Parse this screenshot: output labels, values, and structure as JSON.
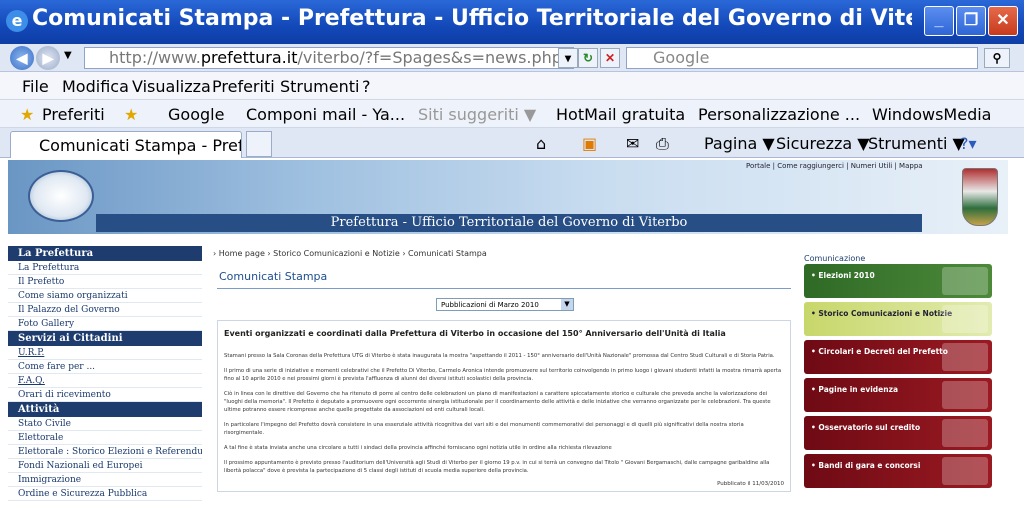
{
  "window": {
    "title": "Comunicati Stampa - Prefettura - Ufficio Territoriale del Governo di Viterbo - W..."
  },
  "address": {
    "url_prefix": "http://www.",
    "url_domain": "prefettura.it",
    "url_rest": "/viterbo/?f=Spages&s=news.php&id_a",
    "search_placeholder": "Google"
  },
  "menu": [
    "File",
    "Modifica",
    "Visualizza",
    "Preferiti",
    "Strumenti",
    "?"
  ],
  "favorites": {
    "label": "Preferiti",
    "items": [
      "Google",
      "Componi mail - Ya...",
      "Siti suggeriti ▼",
      "HotMail gratuita",
      "Personalizzazione ...",
      "WindowsMedia"
    ]
  },
  "tab": {
    "label": "Comunicati Stampa - Prefe..."
  },
  "commands": {
    "page": "Pagina ▼",
    "security": "Sicurezza ▼",
    "tools": "Strumenti ▼"
  },
  "site": {
    "top_links": "Portale | Come raggiungerci | Numeri Utili | Mappa",
    "banner_title": "Prefettura - Ufficio Territoriale del Governo di Viterbo",
    "breadcrumb": "› Home page  › Storico Comunicazioni e Notizie  › Comunicati Stampa",
    "page_title": "Comunicati Stampa",
    "select_value": "Pubblicazioni di Marzo 2010",
    "sections": [
      {
        "title": "La Prefettura",
        "items": [
          "La Prefettura",
          "Il Prefetto",
          "Come siamo organizzati",
          "Il Palazzo del Governo",
          "Foto Gallery"
        ]
      },
      {
        "title": "Servizi ai Cittadini",
        "items": [
          "U.R.P.",
          "Come fare per ...",
          "F.A.Q.",
          "Orari di ricevimento"
        ]
      },
      {
        "title": "Attività",
        "items": [
          "Stato Civile",
          "Elettorale",
          "Elettorale : Storico Elezioni e Referendum",
          "Fondi Nazionali ed Europei",
          "Immigrazione",
          "Ordine e Sicurezza Pubblica"
        ]
      }
    ],
    "article": {
      "heading": "Eventi organizzati e coordinati dalla Prefettura di Viterbo in occasione del 150° Anniversario dell'Unità di Italia",
      "paragraphs": [
        "Stamani presso la Sala Coronas della Prefettura UTG di Viterbo è stata inaugurata la mostra \"aspettando il 2011 - 150° anniversario dell'Unità Nazionale\" promossa dal Centro Studi Culturali e di Storia Patria.",
        "Il primo di una serie di iniziative e momenti celebrativi che il Prefetto Di Viterbo, Carmelo Aronica intende promuovere sul territorio coinvolgendo in primo luogo i giovani studenti infatti la mostra rimarrà aperta fino al 10 aprile 2010 e nei prossimi giorni è prevista l'affluenza di alunni dei diversi istituti scolastici della provincia.",
        "Ciò in linea con le direttive del Governo che ha ritenuto di porre al centro delle celebrazioni un piano di manifestazioni a carattere spiccatamente storico e culturale che preveda anche la valorizzazione dei \"luoghi della memoria\". Il Prefetto è deputato a promuovere ogni occorrente sinergia istituzionale per il coordinamento delle attività e delle iniziative che verranno organizzate per le celebrazioni. Tra queste ultime potranno essere ricomprese anche quelle progettate da associazioni ed enti culturali locali.",
        "In particolare l'impegno del Prefetto dovrà consistere in una essenziale attività ricognitiva dei vari siti e dei monumenti commemorativi dei personaggi e di quelli più significativi della nostra storia risorgimentale.",
        "A tal fine è stata inviata anche una circolare a tutti i sindaci della provincia affinché forniscano ogni notizia utile in ordine alla richiesta rilevazione",
        "Il prossimo appuntamento è previsto presso l'auditorium dell'Università agli Studi di Viterbo per il giorno 19 p.v. in cui si terrà un convegno dal Titolo \" Giovani Bergamaschi, dalle campagne garibaldine alla libertà polacca\" dove è prevista la partecipazione di 5 classi degli istituti di scuola media superiore della provincia."
      ],
      "published": "Pubblicato il 11/03/2010"
    },
    "right_title": "Comunicazione",
    "right_boxes": [
      "Elezioni 2010",
      "Storico Comunicazioni e Notizie",
      "Circolari e Decreti del Prefetto",
      "Pagine in evidenza",
      "Osservatorio sul credito",
      "Bandi di gara e concorsi"
    ]
  }
}
